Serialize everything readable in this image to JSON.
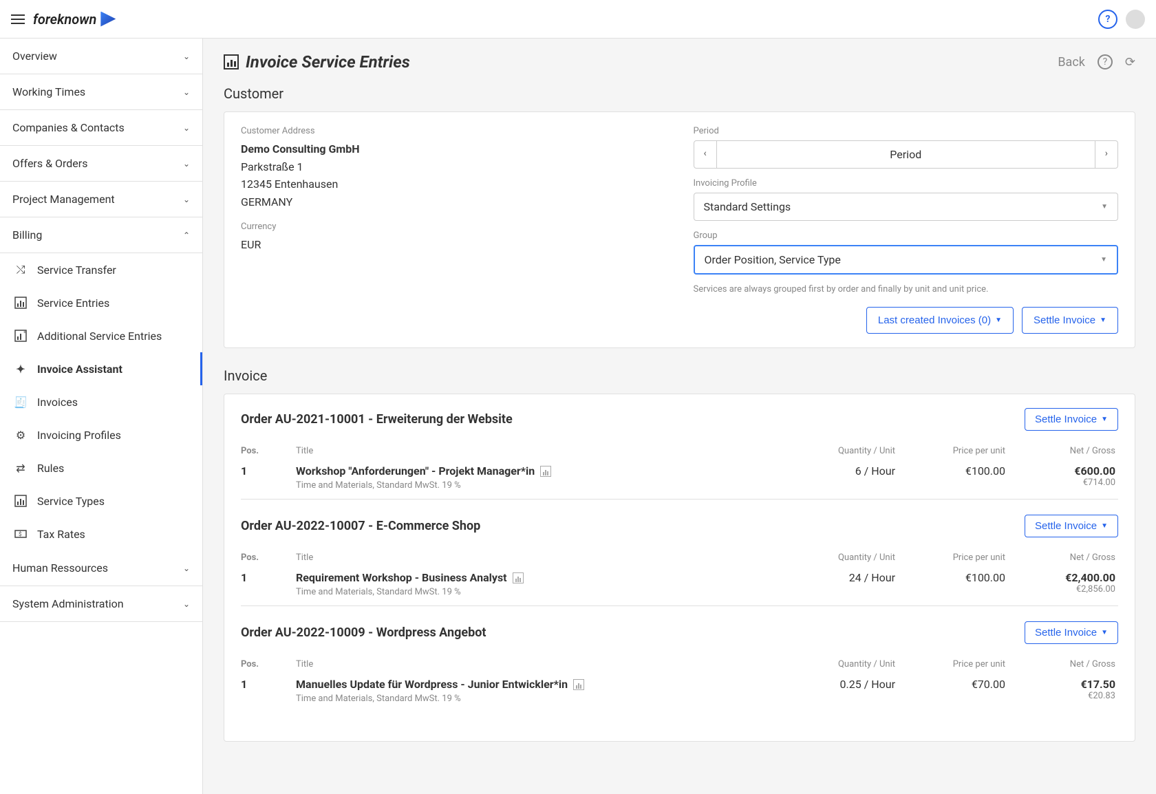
{
  "brand": "foreknown",
  "sidebar": {
    "groups": [
      {
        "label": "Overview",
        "expanded": false
      },
      {
        "label": "Working Times",
        "expanded": false
      },
      {
        "label": "Companies & Contacts",
        "expanded": false
      },
      {
        "label": "Offers & Orders",
        "expanded": false
      },
      {
        "label": "Project Management",
        "expanded": false
      },
      {
        "label": "Billing",
        "expanded": true
      },
      {
        "label": "Human Ressources",
        "expanded": false
      },
      {
        "label": "System Administration",
        "expanded": false
      }
    ],
    "billing_items": [
      {
        "label": "Service Transfer"
      },
      {
        "label": "Service Entries"
      },
      {
        "label": "Additional Service Entries"
      },
      {
        "label": "Invoice Assistant"
      },
      {
        "label": "Invoices"
      },
      {
        "label": "Invoicing Profiles"
      },
      {
        "label": "Rules"
      },
      {
        "label": "Service Types"
      },
      {
        "label": "Tax Rates"
      }
    ]
  },
  "page": {
    "title": "Invoice Service Entries",
    "back": "Back"
  },
  "customer": {
    "section": "Customer",
    "address_label": "Customer Address",
    "name": "Demo Consulting GmbH",
    "street": "Parkstraße 1",
    "city": "12345 Entenhausen",
    "country": "GERMANY",
    "currency_label": "Currency",
    "currency": "EUR",
    "period_label": "Period",
    "period_value": "Period",
    "profile_label": "Invoicing Profile",
    "profile_value": "Standard Settings",
    "group_label": "Group",
    "group_value": "Order Position, Service Type",
    "group_hint": "Services are always grouped first by order and finally by unit and unit price.",
    "last_invoices_btn": "Last created Invoices (0)",
    "settle_btn": "Settle Invoice"
  },
  "invoice": {
    "section": "Invoice",
    "headers": {
      "pos": "Pos.",
      "title": "Title",
      "qty": "Quantity / Unit",
      "price": "Price per unit",
      "net": "Net / Gross"
    },
    "orders": [
      {
        "title": "Order AU-2021-10001 - Erweiterung der Website",
        "settle": "Settle Invoice",
        "lines": [
          {
            "pos": "1",
            "title": "Workshop \"Anforderungen\" - Projekt Manager*in",
            "sub": "Time and Materials, Standard MwSt. 19 %",
            "qty": "6 / Hour",
            "price": "€100.00",
            "net": "€600.00",
            "gross": "€714.00"
          }
        ]
      },
      {
        "title": "Order AU-2022-10007 - E-Commerce Shop",
        "settle": "Settle Invoice",
        "lines": [
          {
            "pos": "1",
            "title": "Requirement Workshop - Business Analyst",
            "sub": "Time and Materials, Standard MwSt. 19 %",
            "qty": "24 / Hour",
            "price": "€100.00",
            "net": "€2,400.00",
            "gross": "€2,856.00"
          }
        ]
      },
      {
        "title": "Order AU-2022-10009 - Wordpress Angebot",
        "settle": "Settle Invoice",
        "lines": [
          {
            "pos": "1",
            "title": "Manuelles Update für Wordpress - Junior Entwickler*in",
            "sub": "Time and Materials, Standard MwSt. 19 %",
            "qty": "0.25 / Hour",
            "price": "€70.00",
            "net": "€17.50",
            "gross": "€20.83"
          }
        ]
      }
    ]
  }
}
